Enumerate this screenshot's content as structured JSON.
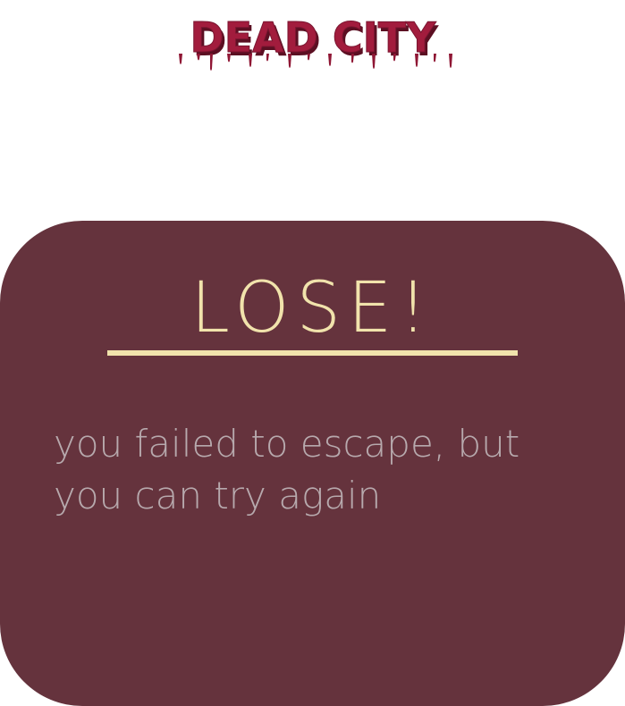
{
  "game": {
    "title": "DEAD CITY"
  },
  "result_panel": {
    "title": "LOSE!",
    "message": "you failed to escape, but you can try again"
  },
  "colors": {
    "logo_red": "#a21c3d",
    "logo_shadow": "#5b0f22",
    "panel_background": "#65333d",
    "title_cream": "#f1e3ac",
    "message_gray": "#b7a9ad"
  },
  "icons": {
    "logo": "dripping-blood-text-logo"
  }
}
